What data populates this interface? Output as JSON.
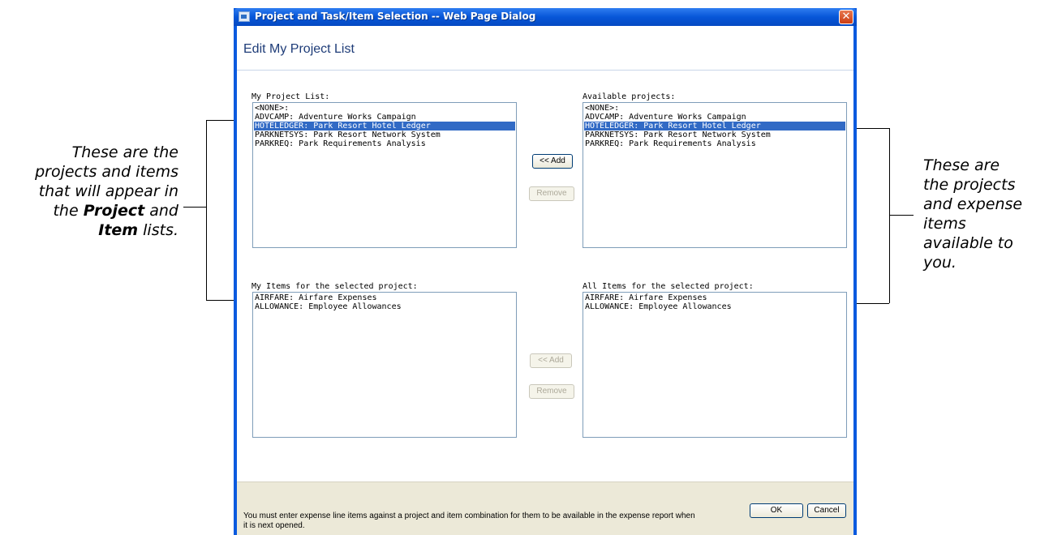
{
  "dialog": {
    "title": "Project and Task/Item Selection -- Web Page Dialog",
    "close_glyph": "✕",
    "page_title": "Edit My Project List"
  },
  "my_projects": {
    "label": "My Project List:",
    "options": [
      {
        "text": "<NONE>:",
        "selected": false
      },
      {
        "text": "ADVCAMP: Adventure Works Campaign",
        "selected": false
      },
      {
        "text": "HOTELEDGER: Park Resort Hotel Ledger",
        "selected": true
      },
      {
        "text": "PARKNETSYS: Park Resort Network System",
        "selected": false
      },
      {
        "text": "PARKREQ: Park Requirements Analysis",
        "selected": false
      }
    ]
  },
  "available_projects": {
    "label": "Available projects:",
    "options": [
      {
        "text": "<NONE>:",
        "selected": false
      },
      {
        "text": "ADVCAMP: Adventure Works Campaign",
        "selected": false
      },
      {
        "text": "HOTELEDGER: Park Resort Hotel Ledger",
        "selected": true
      },
      {
        "text": "PARKNETSYS: Park Resort Network System",
        "selected": false
      },
      {
        "text": "PARKREQ: Park Requirements Analysis",
        "selected": false
      }
    ]
  },
  "my_items": {
    "label": "My Items for the selected project:",
    "options": [
      {
        "text": "AIRFARE: Airfare Expenses",
        "selected": false
      },
      {
        "text": "ALLOWANCE: Employee Allowances",
        "selected": false
      }
    ]
  },
  "all_items": {
    "label": "All Items for the selected project:",
    "options": [
      {
        "text": "AIRFARE: Airfare Expenses",
        "selected": false
      },
      {
        "text": "ALLOWANCE: Employee Allowances",
        "selected": false
      }
    ]
  },
  "buttons": {
    "project_add": "<< Add",
    "project_remove": "Remove",
    "item_add": "<< Add",
    "item_remove": "Remove",
    "ok": "OK",
    "cancel": "Cancel"
  },
  "footer": {
    "note": "You must enter expense line items against a project and item combination for them to be available in the expense report when it is next opened."
  },
  "callouts": {
    "left": {
      "line1": "These are the",
      "line2": "projects and items",
      "line3": "that will appear in",
      "line4_pre": "the ",
      "line4_bold": "Project",
      "line4_post": " and",
      "line5_bold": "Item",
      "line5_post": " lists."
    },
    "right": {
      "line1": "These are",
      "line2": "the projects",
      "line3": "and expense",
      "line4": "items",
      "line5": "available to",
      "line6": "you."
    }
  }
}
